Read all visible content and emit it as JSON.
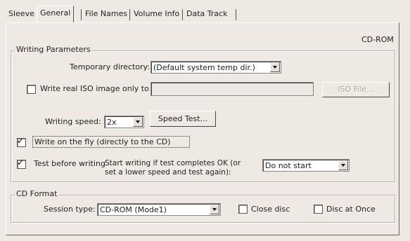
{
  "tabs": [
    {
      "label": "Sleeve"
    },
    {
      "label": "General"
    },
    {
      "label": "File Names"
    },
    {
      "label": "Volume Info"
    },
    {
      "label": "Data Track"
    }
  ],
  "media_type": "CD-ROM",
  "writing_parameters": {
    "legend": "Writing Parameters",
    "temp_dir_label": "Temporary directory:",
    "temp_dir_value": "(Default system temp dir.)",
    "write_iso_label": "Write real ISO image only to",
    "write_iso_checked": false,
    "iso_path_value": "",
    "iso_file_button": "ISO File...",
    "speed_label": "Writing speed:",
    "speed_value": "2x",
    "speed_test_button": "Speed Test...",
    "on_the_fly_label": "Write on the fly (directly to the CD)",
    "on_the_fly_checked": true,
    "test_before_label": "Test before writing",
    "test_before_checked": true,
    "start_writing_line1": "Start writing if test completes OK (or",
    "start_writing_line2": "set a lower speed and test again):",
    "start_writing_value": "Do not start"
  },
  "cd_format": {
    "legend": "CD Format",
    "session_type_label": "Session type:",
    "session_type_value": "CD-ROM (Mode1)",
    "close_disc_label": "Close disc",
    "close_disc_checked": false,
    "disc_at_once_label": "Disc at Once",
    "disc_at_once_checked": false
  },
  "colors": {
    "dialog_bg": "#eeeae3",
    "field_bg": "#ffffff",
    "disabled_text": "#a9a49c"
  },
  "icons": {
    "check": "check-icon",
    "dropdown": "chevron-down-icon"
  }
}
